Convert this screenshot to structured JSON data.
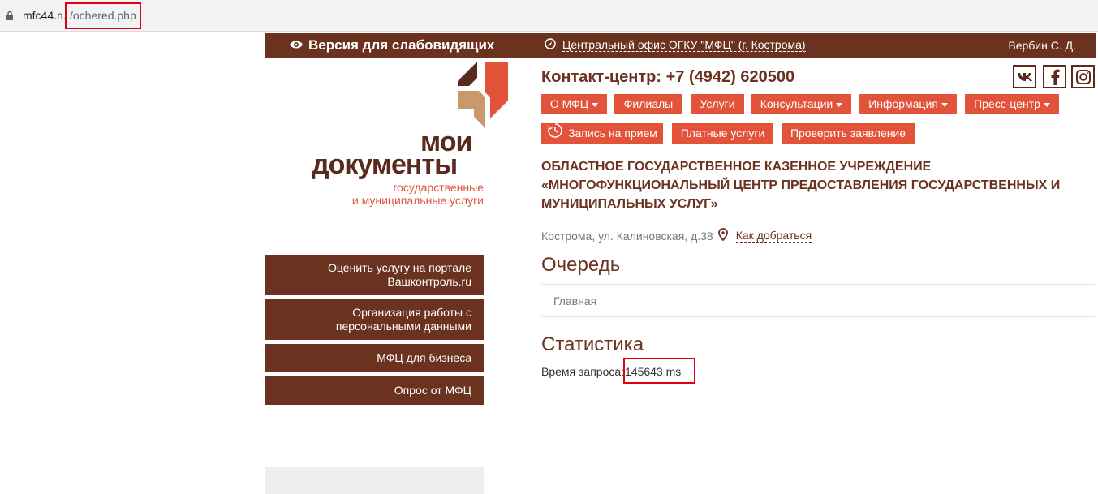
{
  "browser": {
    "url_host": "mfc44.ru",
    "url_path": "/ochered.php"
  },
  "topbar": {
    "vision_label": "Версия для слабовидящих",
    "office_label": "Центральный офис ОГКУ \"МФЦ\" (г. Кострома)",
    "user_name": "Вербин С. Д."
  },
  "logo": {
    "word1": "мои",
    "word2": "документы",
    "sub1": "государственные",
    "sub2": "и муниципальные услуги"
  },
  "contact": {
    "label": "Контакт-центр: +7 (4942) 620500"
  },
  "social": [
    "vk-icon",
    "facebook-icon",
    "instagram-icon"
  ],
  "nav": {
    "row1": [
      {
        "label": "О МФЦ",
        "dropdown": true
      },
      {
        "label": "Филиалы",
        "dropdown": false
      },
      {
        "label": "Услуги",
        "dropdown": false
      },
      {
        "label": "Консультации",
        "dropdown": true
      },
      {
        "label": "Информация",
        "dropdown": true
      },
      {
        "label": "Пресс-центр",
        "dropdown": true
      }
    ],
    "row2": [
      {
        "label": "Запись на прием",
        "icon": "clock-icon"
      },
      {
        "label": "Платные услуги"
      },
      {
        "label": "Проверить заявление"
      }
    ]
  },
  "org": {
    "line1": "ОБЛАСТНОЕ ГОСУДАРСТВЕННОЕ КАЗЕННОЕ УЧРЕЖДЕНИЕ",
    "line2": "«МНОГОФУНКЦИОНАЛЬНЫЙ ЦЕНТР ПРЕДОСТАВЛЕНИЯ ГОСУДАРСТВЕННЫХ И",
    "line3": "МУНИЦИПАЛЬНЫХ УСЛУГ»",
    "address": "Кострома, ул. Калиновская, д.38",
    "directions": "Как добраться"
  },
  "sidebar": {
    "items": [
      {
        "line1": "Оценить услугу на портале",
        "line2": "Вашконтроль.ru"
      },
      {
        "line1": "Организация работы с",
        "line2": "персональными данными"
      },
      {
        "line1": "МФЦ для бизнеса",
        "line2": ""
      },
      {
        "line1": "Опрос от МФЦ",
        "line2": ""
      }
    ]
  },
  "main": {
    "page_title": "Очередь",
    "breadcrumb": "Главная",
    "stats_title": "Статистика",
    "request_label": "Время запроса:",
    "request_value": "145643 ms"
  },
  "colors": {
    "brown": "#6b3220",
    "accent": "#e2533a",
    "highlight": "#e0000f"
  }
}
